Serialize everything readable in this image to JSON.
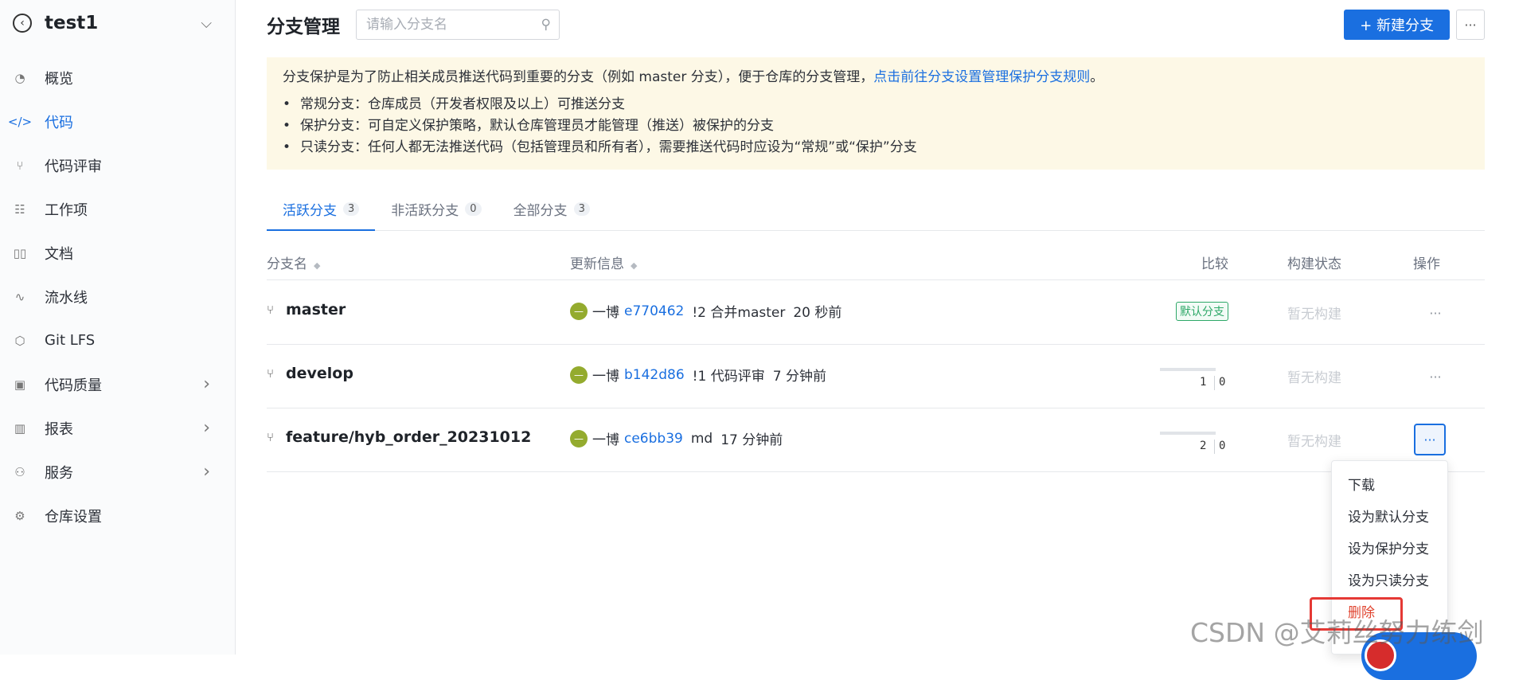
{
  "sidebar": {
    "repo_name": "test1",
    "items": [
      {
        "label": "概览",
        "icon": "gauge-icon"
      },
      {
        "label": "代码",
        "icon": "code-icon",
        "active": true
      },
      {
        "label": "代码评审",
        "icon": "merge-request-icon"
      },
      {
        "label": "工作项",
        "icon": "checklist-icon"
      },
      {
        "label": "文档",
        "icon": "book-icon"
      },
      {
        "label": "流水线",
        "icon": "pipeline-icon"
      },
      {
        "label": "Git LFS",
        "icon": "cube-icon"
      },
      {
        "label": "代码质量",
        "icon": "quality-icon",
        "has_arrow": true
      },
      {
        "label": "报表",
        "icon": "bar-chart-icon",
        "has_arrow": true
      },
      {
        "label": "服务",
        "icon": "service-icon",
        "has_arrow": true
      },
      {
        "label": "仓库设置",
        "icon": "gear-icon"
      }
    ]
  },
  "header": {
    "title": "分支管理",
    "search_placeholder": "请输入分支名",
    "new_branch_label": "+ 新建分支",
    "more_label": "···"
  },
  "notice": {
    "intro": "分支保护是为了防止相关成员推送代码到重要的分支（例如 master 分支），便于仓库的分支管理，",
    "link": "点击前往分支设置管理保护分支规则",
    "period": "。",
    "bullets": [
      "常规分支：仓库成员（开发者权限及以上）可推送分支",
      "保护分支：可自定义保护策略，默认仓库管理员才能管理（推送）被保护的分支",
      "只读分支：任何人都无法推送代码（包括管理员和所有者），需要推送代码时应设为“常规”或“保护”分支"
    ]
  },
  "tabs": [
    {
      "label": "活跃分支",
      "count": "3",
      "active": true
    },
    {
      "label": "非活跃分支",
      "count": "0"
    },
    {
      "label": "全部分支",
      "count": "3"
    }
  ],
  "table": {
    "headers": {
      "name": "分支名",
      "info": "更新信息",
      "compare": "比较",
      "build": "构建状态",
      "ops": "操作"
    },
    "rows": [
      {
        "name": "master",
        "author": "一博",
        "commit": "e770462",
        "message": "!2 合并master",
        "time": "20 秒前",
        "default_badge": "默认分支",
        "behind": "",
        "ahead": "",
        "build": "暂无构建"
      },
      {
        "name": "develop",
        "author": "一博",
        "commit": "b142d86",
        "message": "!1 代码评审",
        "time": "7 分钟前",
        "behind": "1",
        "ahead": "0",
        "build": "暂无构建"
      },
      {
        "name": "feature/hyb_order_20231012",
        "author": "一博",
        "commit": "ce6bb39",
        "message": "md",
        "time": "17 分钟前",
        "behind": "2",
        "ahead": "0",
        "build": "暂无构建"
      }
    ]
  },
  "dropdown": {
    "items": [
      "下载",
      "设为默认分支",
      "设为保护分支",
      "设为只读分支",
      "删除"
    ]
  },
  "watermark": "CSDN @艾莉丝努力练剑",
  "colors": {
    "accent": "#1a6fe0",
    "danger": "#e0442f",
    "success": "#2ea868",
    "notice_bg": "#fdf8e6"
  }
}
